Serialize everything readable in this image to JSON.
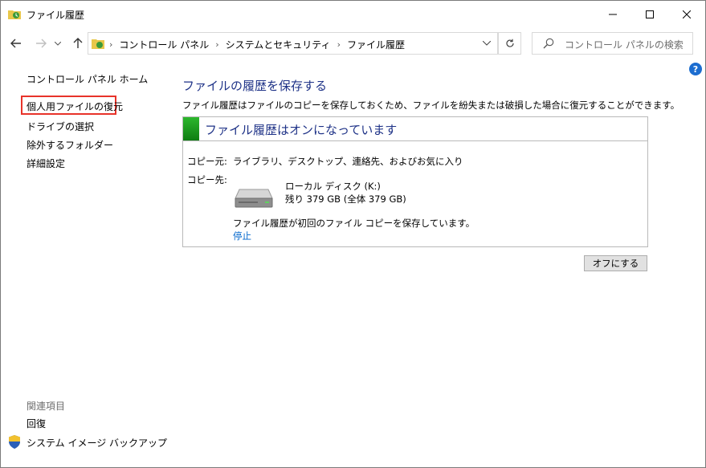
{
  "window": {
    "title": "ファイル履歴"
  },
  "address": {
    "crumbs": [
      "コントロール パネル",
      "システムとセキュリティ",
      "ファイル履歴"
    ]
  },
  "search": {
    "placeholder": "コントロール パネルの検索"
  },
  "help": {
    "label": "?"
  },
  "sidebar": {
    "home": "コントロール パネル ホーム",
    "items": [
      "個人用ファイルの復元",
      "ドライブの選択",
      "除外するフォルダー",
      "詳細設定"
    ],
    "see_also_heading": "関連項目",
    "see_also": [
      "回復",
      "システム イメージ バックアップ"
    ]
  },
  "main": {
    "heading": "ファイルの履歴を保存する",
    "description": "ファイル履歴はファイルのコピーを保存しておくため、ファイルを紛失または破損した場合に復元することができます。",
    "status_title": "ファイル履歴はオンになっています",
    "copy_from_label": "コピー元:",
    "copy_from_value": "ライブラリ、デスクトップ、連絡先、およびお気に入り",
    "copy_to_label": "コピー先:",
    "drive_name": "ローカル ディスク (K:)",
    "drive_free": "残り 379 GB (全体 379 GB)",
    "copy_status": "ファイル履歴が初回のファイル コピーを保存しています。",
    "stop_link": "停止",
    "off_button": "オフにする"
  },
  "colors": {
    "accent": "#1e3287",
    "link": "#0066cc",
    "highlight": "#e8332a",
    "status": "#1a9a1a"
  },
  "icons": [
    "file-history-icon",
    "back-arrow-icon",
    "forward-arrow-icon",
    "up-arrow-icon",
    "refresh-icon",
    "search-icon",
    "help-icon",
    "shield-icon",
    "drive-icon"
  ]
}
